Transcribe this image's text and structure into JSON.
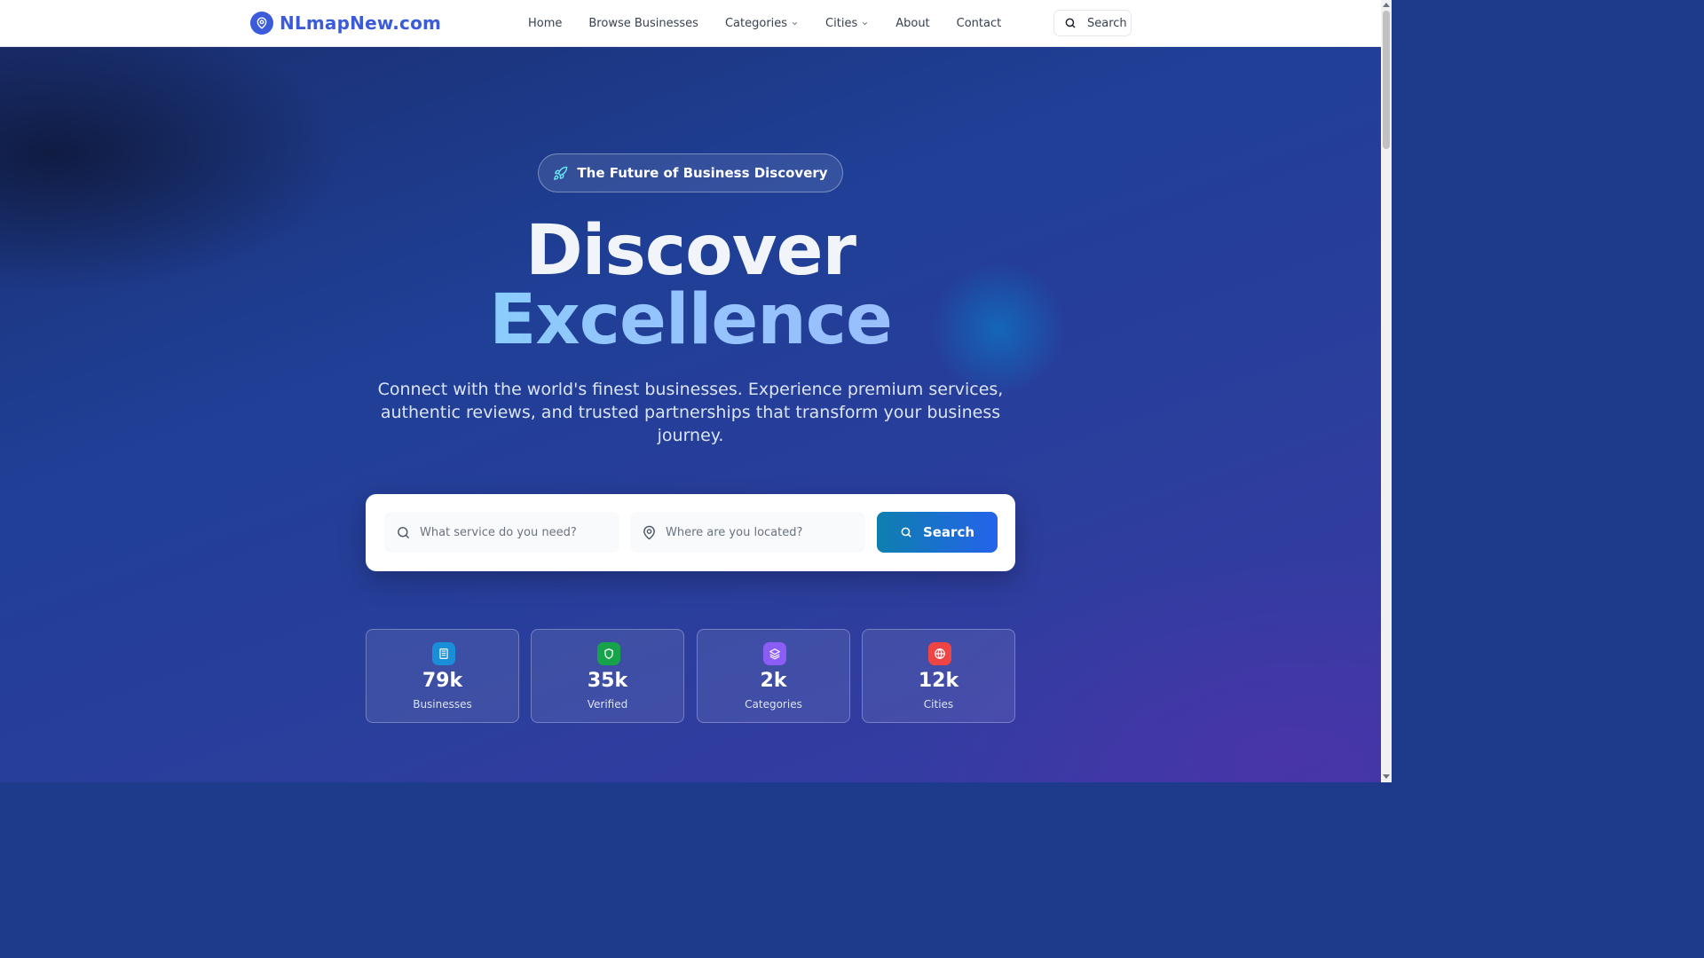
{
  "nav": {
    "brand": "NLmapNew.com",
    "links": [
      {
        "label": "Home"
      },
      {
        "label": "Browse Businesses"
      },
      {
        "label": "Categories"
      },
      {
        "label": "Cities"
      },
      {
        "label": "About"
      },
      {
        "label": "Contact"
      }
    ],
    "search_label": "Search"
  },
  "hero": {
    "badge": "The Future of Business Discovery",
    "title_line1": "Discover",
    "title_line2": "Excellence",
    "subtitle": "Connect with the world's finest businesses. Experience premium services, authentic reviews, and trusted partnerships that transform your business journey."
  },
  "search": {
    "service_placeholder": "What service do you need?",
    "location_placeholder": "Where are you located?",
    "button_label": "Search"
  },
  "stats": [
    {
      "value": "79k",
      "label": "Businesses",
      "icon": "building-icon",
      "color": "#1a8ed8"
    },
    {
      "value": "35k",
      "label": "Verified",
      "icon": "shield-icon",
      "color": "#16a34a"
    },
    {
      "value": "2k",
      "label": "Categories",
      "icon": "layers-icon",
      "color": "#8b5cf6"
    },
    {
      "value": "12k",
      "label": "Cities",
      "icon": "globe-icon",
      "color": "#ef4444"
    }
  ],
  "colors": {
    "brand": "#3b5bdb",
    "hero_bg": "#1f3f96",
    "search_button": "#1d6fd0"
  }
}
